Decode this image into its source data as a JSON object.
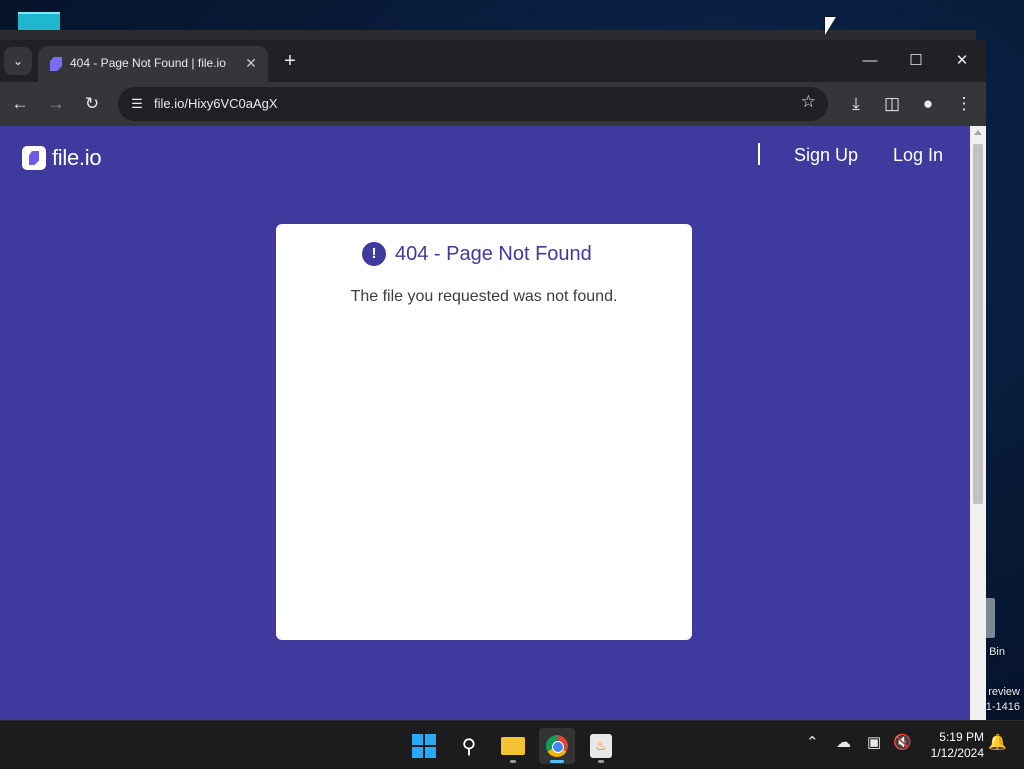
{
  "desktop": {
    "recycle_bin_label": "Bin",
    "preview_label_line1": "review",
    "preview_label_line2": "1-1416"
  },
  "browser": {
    "tab": {
      "title": "404 - Page Not Found | file.io"
    },
    "address": "file.io/Hixy6VC0aAgX"
  },
  "page": {
    "logo_text": "file.io",
    "nav": {
      "sign_up": "Sign Up",
      "log_in": "Log In"
    },
    "error": {
      "icon_glyph": "!",
      "title": "404 - Page Not Found",
      "message": "The file you requested was not found."
    },
    "colors": {
      "background": "#3f3a9e",
      "card": "#ffffff"
    }
  },
  "taskbar": {
    "time": "5:19 PM",
    "date": "1/12/2024"
  }
}
